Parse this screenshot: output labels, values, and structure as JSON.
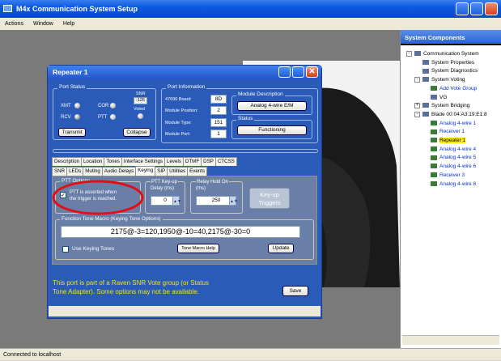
{
  "app": {
    "title": "M4x Communication System Setup"
  },
  "menu": [
    "Actions",
    "Window",
    "Help"
  ],
  "status_bar": "Connected to localhost",
  "side_panel": {
    "title": "System Components",
    "tree": [
      {
        "label": "Communication System",
        "indent": 0,
        "expander": "-",
        "color": "black"
      },
      {
        "label": "System Properties",
        "indent": 1,
        "expander": "",
        "color": "black"
      },
      {
        "label": "System Diagnostics",
        "indent": 1,
        "expander": "",
        "color": "black"
      },
      {
        "label": "System Voting",
        "indent": 1,
        "expander": "-",
        "color": "black"
      },
      {
        "label": "Add Vote Group",
        "indent": 2,
        "expander": "",
        "color": "blue"
      },
      {
        "label": "VG",
        "indent": 2,
        "expander": "",
        "color": "black"
      },
      {
        "label": "System Bridging",
        "indent": 1,
        "expander": "+",
        "color": "black"
      },
      {
        "label": "Blade 00:04:A3:19:E1:8",
        "indent": 1,
        "expander": "-",
        "color": "black"
      },
      {
        "label": "Analog 4-wire 1",
        "indent": 2,
        "expander": "",
        "color": "blue"
      },
      {
        "label": "Receiver 1",
        "indent": 2,
        "expander": "",
        "color": "blue"
      },
      {
        "label": "Repeater 1",
        "indent": 2,
        "expander": "",
        "color": "blue",
        "selected": true
      },
      {
        "label": "Analog 4-wire 4",
        "indent": 2,
        "expander": "",
        "color": "blue"
      },
      {
        "label": "Analog 4-wire 5",
        "indent": 2,
        "expander": "",
        "color": "blue"
      },
      {
        "label": "Analog 4-wire 6",
        "indent": 2,
        "expander": "",
        "color": "blue"
      },
      {
        "label": "Receiver 3",
        "indent": 2,
        "expander": "",
        "color": "blue"
      },
      {
        "label": "Analog 4-wire 8",
        "indent": 2,
        "expander": "",
        "color": "blue"
      }
    ]
  },
  "dialog": {
    "title": "Repeater 1",
    "port_status": {
      "label": "Port Status",
      "xmt": "XMT",
      "rcv": "RCV",
      "cor": "COR",
      "ptt": "PTT",
      "snr_label": "SNR",
      "snr_value": "-126",
      "voted_label": "Voted",
      "transmit_btn": "Transmit",
      "collapse_btn": "Collapse"
    },
    "port_info": {
      "label": "Port Information",
      "board_label": "47696 Board",
      "board_value": "8D",
      "module_position_label": "Module Position:",
      "module_position_value": "2",
      "module_type_label": "Module Type:",
      "module_type_value": "151",
      "module_port_label": "Module Port:",
      "module_port_value": "1"
    },
    "module_description": {
      "label": "Module Description",
      "value": "Analog 4-wire E/M"
    },
    "status": {
      "label": "Status",
      "value": "Functioning"
    },
    "tabs_row1": [
      "Description",
      "Location",
      "Tones",
      "Interface Settings",
      "Levels",
      "DTMF",
      "DSP",
      "CTCSS"
    ],
    "tabs_row2": [
      "SNR",
      "LEDs",
      "Muting",
      "Audio Delays",
      "Keying",
      "SIP",
      "Utilities",
      "Events"
    ],
    "active_tab": "Keying",
    "ptt_options": {
      "label": "PTT Options",
      "checkbox_text_1": "PTT is asserted when",
      "checkbox_text_2": "the trigger is reached.",
      "checked": true
    },
    "ptt_keyup": {
      "label_1": "PTT Key-up",
      "label_2": "Delay (ms)",
      "value": "0"
    },
    "relay_hold": {
      "label_1": "Relay Hold On",
      "label_2": "(ms)",
      "value": "250"
    },
    "keyup_triggers_btn_1": "Key-up",
    "keyup_triggers_btn_2": "Triggers",
    "function_tone": {
      "label": "Function Tone Macro (Keying Tone Options)",
      "value": "2175@-3=120,1950@-10=40,2175@-30=0"
    },
    "use_keying_tones": "Use Keying Tones",
    "tone_macro_help_btn": "Tone Macro Help",
    "update_btn": "Update",
    "footer_note_1": "This port is part of a Raven SNR Vote group (or Status",
    "footer_note_2": "Tone Adapter).  Some options may not be available.",
    "save_btn": "Save"
  },
  "colors": {
    "titlebar": "#0a5ae0",
    "dialog_bg": "#2a5bb8",
    "highlight_circle": "#e0101a",
    "selected_tree": "#ffe800",
    "note_text": "#f5e600"
  }
}
